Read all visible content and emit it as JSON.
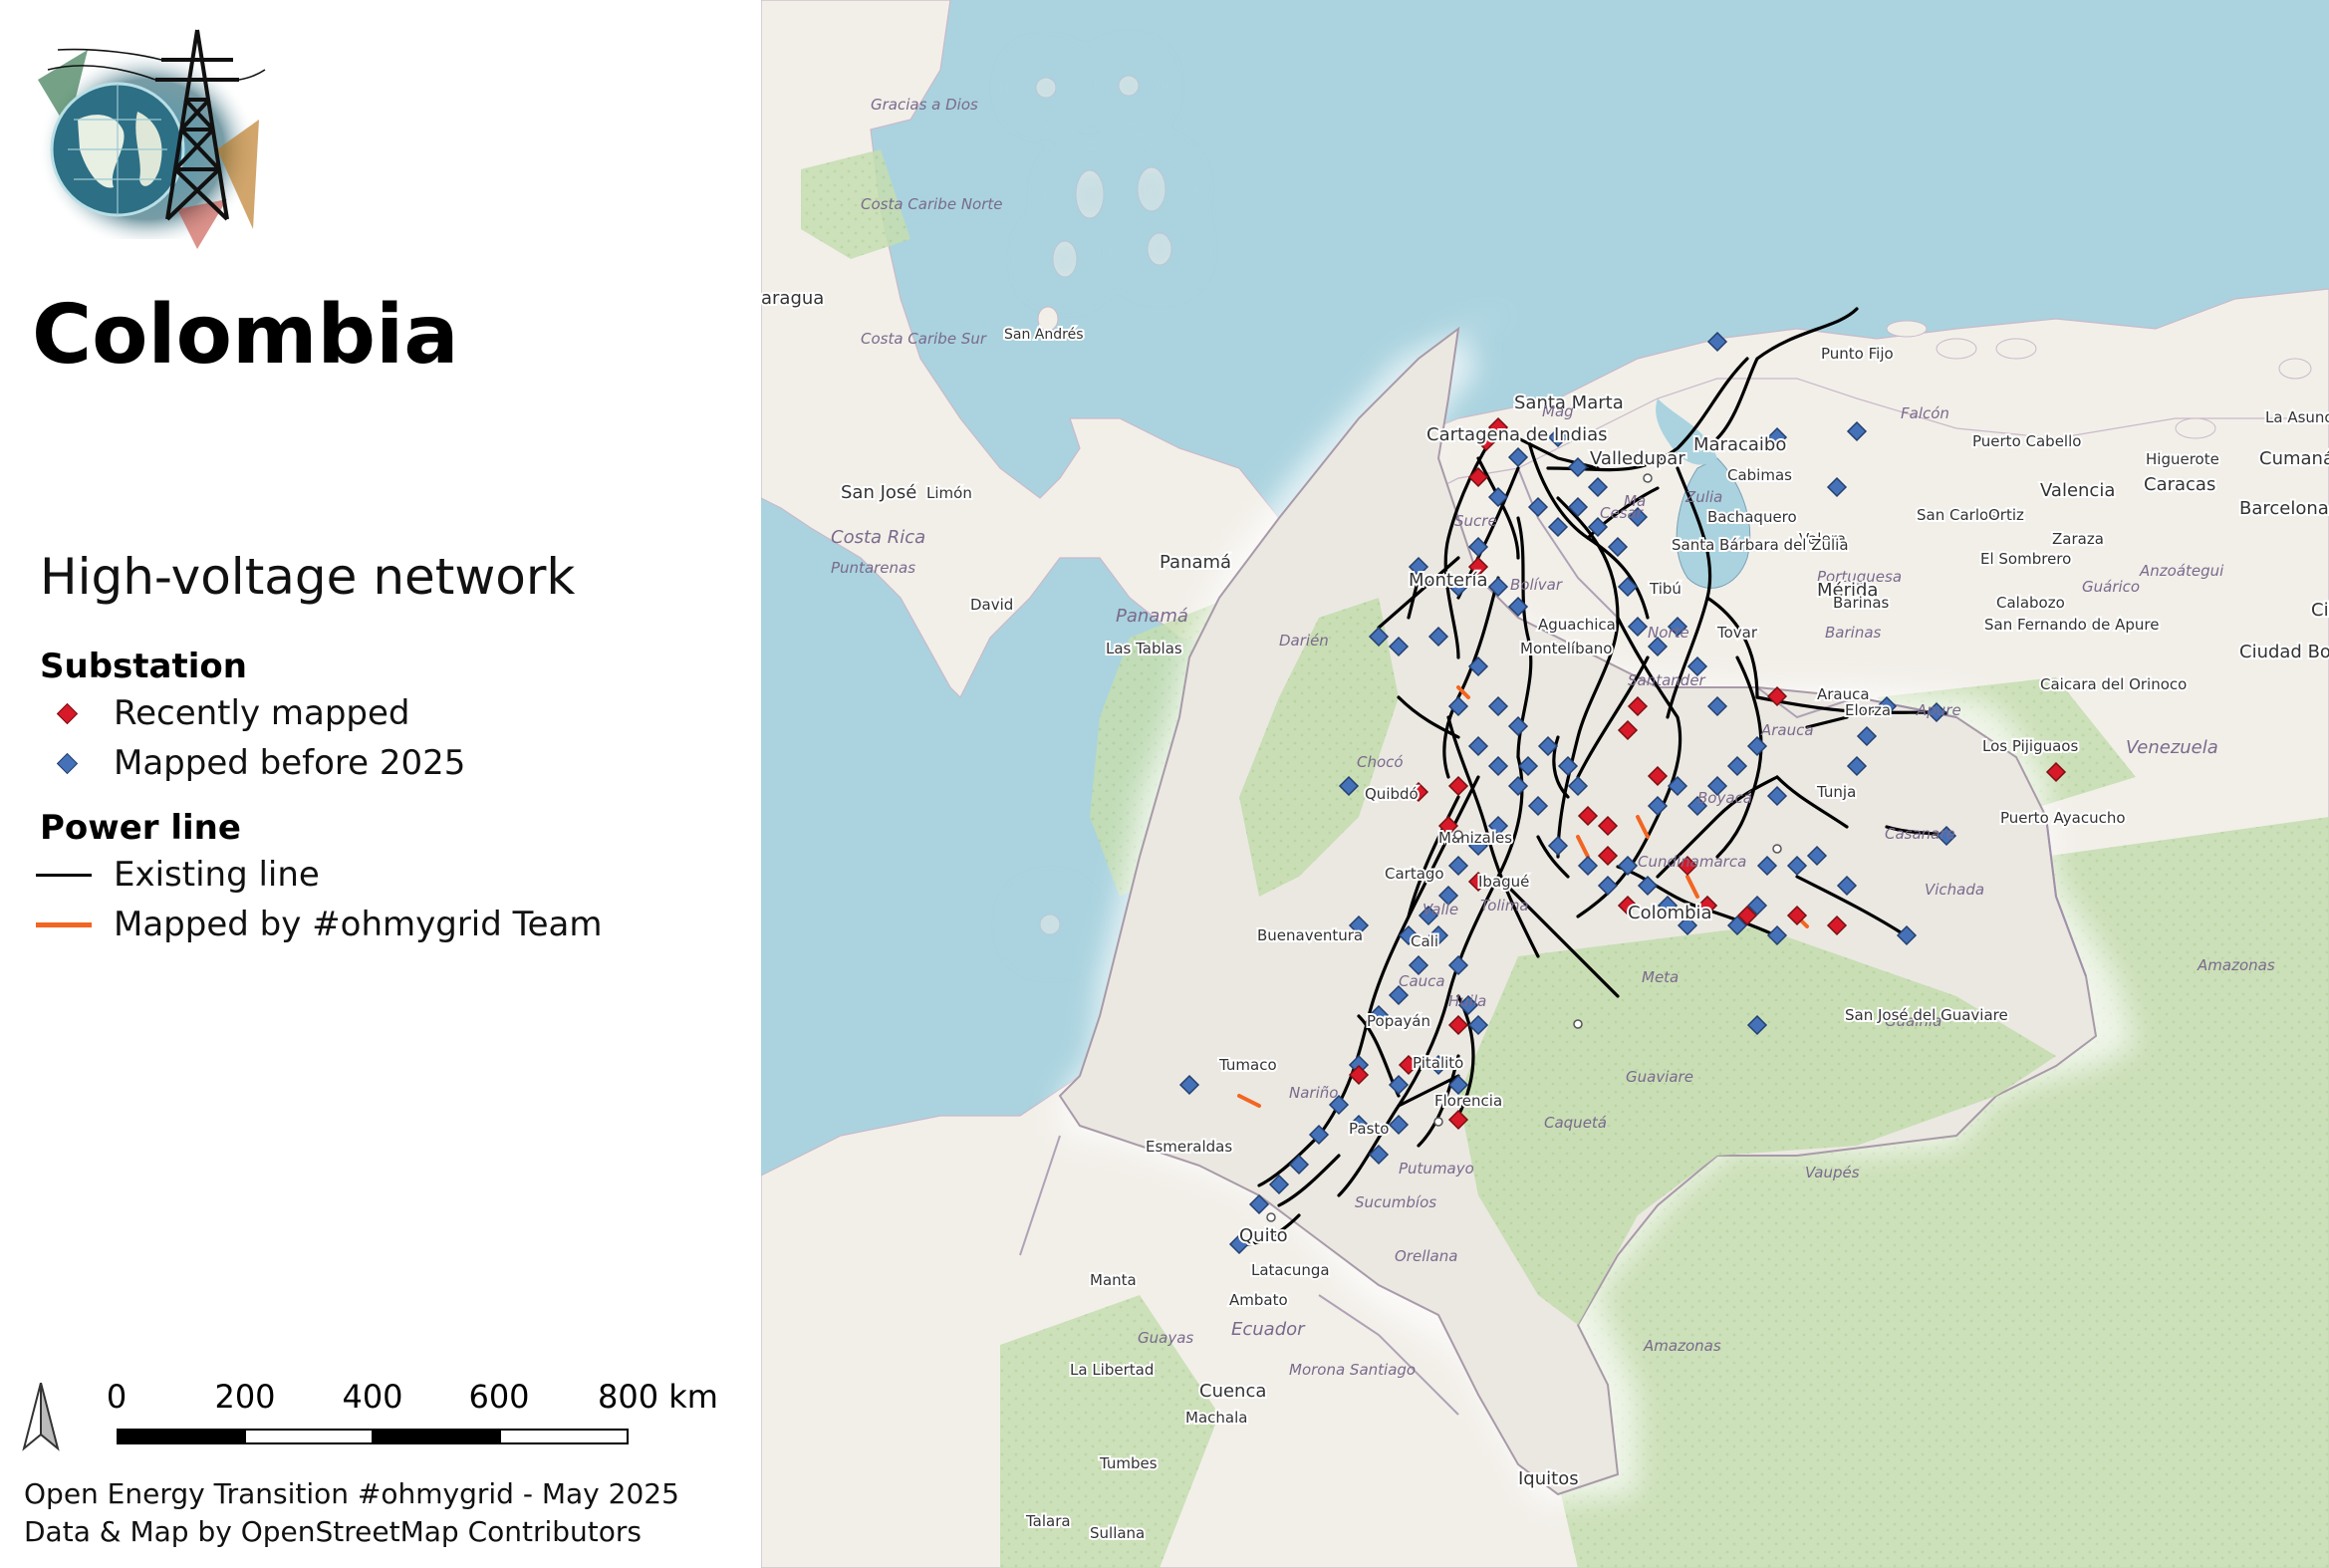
{
  "title": "Colombia",
  "network_title": "High-voltage network",
  "legend": {
    "substation_heading": "Substation",
    "substation_items": [
      {
        "label": "Recently mapped",
        "color": "#d7192a",
        "icon": "red-diamond-icon"
      },
      {
        "label": "Mapped before 2025",
        "color": "#4471b8",
        "icon": "blue-diamond-icon"
      }
    ],
    "power_line_heading": "Power line",
    "power_line_items": [
      {
        "label": "Existing line",
        "color": "#000000",
        "icon": "black-line-icon"
      },
      {
        "label": "Mapped by #ohmygrid Team",
        "color": "#f26522",
        "icon": "orange-line-icon"
      }
    ]
  },
  "scalebar": {
    "ticks": [
      "0",
      "200",
      "400",
      "600",
      "800 km"
    ]
  },
  "credits": [
    "Open Energy Transition #ohmygrid - May 2025",
    "Data & Map by OpenStreetMap Contributors"
  ],
  "colors": {
    "sea": "#aad3df",
    "land": "#f2efe9",
    "forest": "#c8dfb0",
    "colombia": "#ebe8e2",
    "substation_recent": "#d7192a",
    "substation_before": "#4471b8",
    "line_existing": "#000000",
    "line_ohmygrid": "#f26522"
  },
  "map": {
    "places": [
      "Gracias a Dios",
      "Costa Caribe Norte",
      "aragua",
      "Costa Caribe Sur",
      "San Andrés",
      "San José",
      "Limón",
      "Costa Rica",
      "Puntarenas",
      "David",
      "Panamá",
      "Panamá",
      "Las Tablas",
      "Darién",
      "Santa Marta",
      "Cartagena de Indias",
      "Valledupar",
      "Maracaibo",
      "Punto Fijo",
      "Falcón",
      "Puerto Cabello",
      "Valencia",
      "Caracas",
      "Barcelona",
      "Cumaná",
      "La Asunción",
      "Higuerote",
      "Cabimas",
      "San Carlos",
      "Ortiz",
      "Zaraza",
      "Bachaquero",
      "Valera",
      "El Sombrero",
      "Anzoátegui",
      "Zulia",
      "Santa Bárbara del Zulia",
      "Portuguesa",
      "Mérida",
      "Barinas",
      "Calabozo",
      "Guárico",
      "Barinas",
      "San Fernando de Apure",
      "Ciudad Bolívar",
      "Ciu",
      "Montería",
      "Aguachica",
      "Montelíbano",
      "Tibú",
      "Tovar",
      "Arauca",
      "Arauca",
      "Elorza",
      "Apure",
      "Caicara del Orinoco",
      "Venezuela",
      "Los Pijiguaos",
      "Puerto Ayacucho",
      "Chocó",
      "Quibdó",
      "Tunja",
      "Casanare",
      "Vichada",
      "Cartago",
      "Manizales",
      "Ibagué",
      "Colombia",
      "Buenaventura",
      "Meta",
      "Amazonas",
      "Guainía",
      "San José del Guaviare",
      "Guaviare",
      "Tumaco",
      "Nariño",
      "Popayán",
      "Pitalito",
      "Florencia",
      "Caquetá",
      "Putumayo",
      "Esmeraldas",
      "Sucumbíos",
      "Vaupés",
      "Quito",
      "Latacunga",
      "Manta",
      "Ambato",
      "Ecuador",
      "Orellana",
      "Guayas",
      "Morona Santiago",
      "La Libertad",
      "Cuenca",
      "Machala",
      "Amazonas",
      "Tumbes",
      "Talara",
      "Sullana",
      "Iquitos",
      "Mag",
      "Bolívar",
      "Santander",
      "Norte",
      "Cesar",
      "Ma",
      "Sucre",
      "Tolima",
      "Valle",
      "Cali",
      "Cauca",
      "Huila",
      "Pasto",
      "Boyacá",
      "Cundinamarca"
    ]
  }
}
